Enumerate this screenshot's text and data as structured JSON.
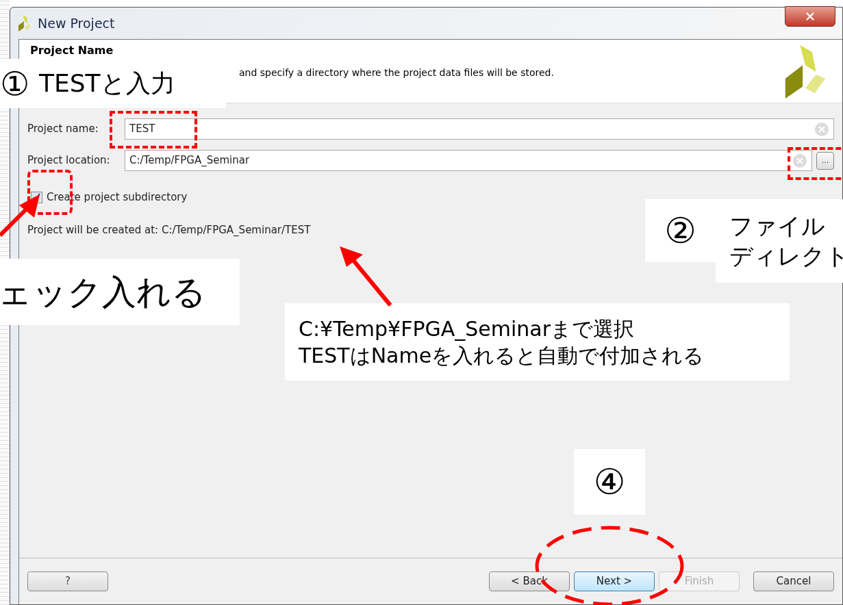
{
  "window": {
    "title": "New Project"
  },
  "header": {
    "title": "Project Name",
    "description": "and specify a directory where the project data files will be stored."
  },
  "project_name": {
    "label": "Project name:",
    "value": "TEST"
  },
  "project_location": {
    "label": "Project location:",
    "value": "C:/Temp/FPGA_Seminar",
    "browse_button": "..."
  },
  "subdirectory": {
    "label": "Create project subdirectory",
    "checked": true
  },
  "created_at": "Project will be created at: C:/Temp/FPGA_Seminar/TEST",
  "help_button": "?",
  "buttons": [
    {
      "label": "< Back",
      "disabled": false,
      "default": false
    },
    {
      "label": "Next >",
      "disabled": false,
      "default": true
    },
    {
      "label": "Finish",
      "disabled": true,
      "default": false
    },
    {
      "label": "Cancel",
      "disabled": false,
      "default": false
    }
  ],
  "annotation_1": {
    "marker": "①",
    "text": "TESTと入力"
  },
  "annotation_check": {
    "text": "ェック入れる"
  },
  "annotation_2": {
    "marker": "②",
    "lines": [
      "ファイル",
      "ディレクト"
    ]
  },
  "annotation_note": {
    "lines": [
      "C:¥Temp¥FPGA_Seminarまで選択",
      "TESTはNameを入れると自動で付加される"
    ]
  },
  "annotation_4": {
    "marker": "④"
  }
}
